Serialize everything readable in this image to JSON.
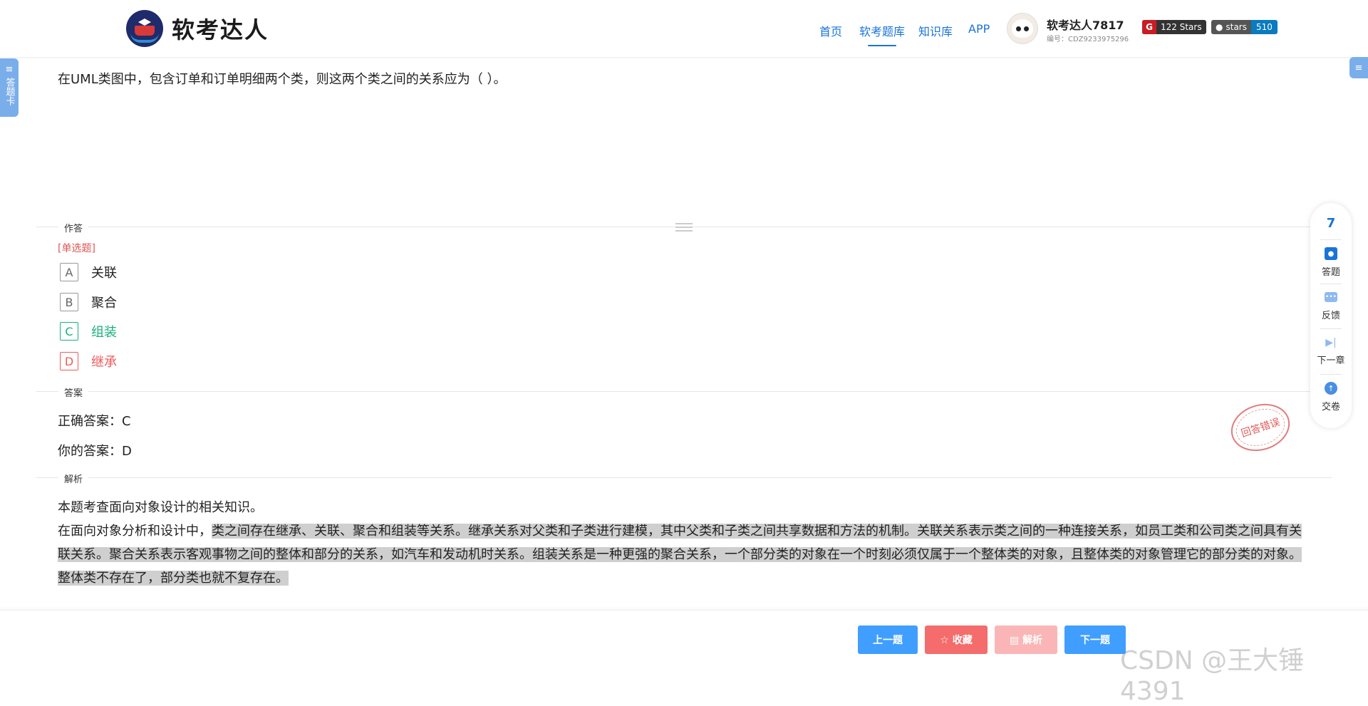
{
  "header": {
    "logo_text": "软考达人",
    "nav": [
      {
        "label": "首页",
        "active": false
      },
      {
        "label": "软考题库",
        "active": true
      },
      {
        "label": "知识库",
        "active": false
      },
      {
        "label": "APP",
        "active": false
      }
    ],
    "user": {
      "name": "软考达人7817",
      "id": "编号：CDZ9233975296"
    },
    "badges": {
      "gitee_label": "122 Stars",
      "github_label": "stars",
      "github_count": "510"
    }
  },
  "side": {
    "answer_card": "答题卡"
  },
  "question": {
    "text": "在UML类图中，包含订单和订单明细两个类，则这两个类之间的关系应为（ ）。",
    "type": "[单选题]",
    "options": [
      {
        "letter": "A",
        "label": "关联",
        "state": "normal"
      },
      {
        "letter": "B",
        "label": "聚合",
        "state": "normal"
      },
      {
        "letter": "C",
        "label": "组装",
        "state": "correct"
      },
      {
        "letter": "D",
        "label": "继承",
        "state": "wrong"
      }
    ]
  },
  "sections": {
    "answer_area": "作答",
    "answer": "答案",
    "analysis": "解析"
  },
  "answer": {
    "correct": "正确答案：C",
    "yours": "你的答案：D"
  },
  "analysis": {
    "line1": "本题考查面向对象设计的相关知识。",
    "line2_prefix": "在面向对象分析和设计中，",
    "line2_highlight": "类之间存在继承、关联、聚合和组装等关系。继承关系对父类和子类进行建模，其中父类和子类之间共享数据和方法的机制。关联关系表示类之间的一种连接关系，如员工类和公司类之间具有关联关系。聚合关系表示客观事物之间的整体和部分的关系，如汽车和发动机时关系。组装关系是一种更强的聚合关系，一个部分类的对象在一个时刻必须仅属于一个整体类的对象，且整体类的对象管理它的部分类的对象。整体类不存在了，部分类也就不复存在。"
  },
  "stamp": "回答错误",
  "toolbar": {
    "count": "7",
    "items": [
      "答题",
      "反馈",
      "下一章",
      "交卷"
    ]
  },
  "bottom": {
    "prev": "上一题",
    "fav": "☆ 收藏",
    "analysis": "▤ 解析",
    "next": "下一题"
  },
  "watermark": "CSDN @王大锤4391",
  "colors": {
    "primary": "#409eff",
    "correct": "#19b07b",
    "wrong": "#f05a5a"
  }
}
